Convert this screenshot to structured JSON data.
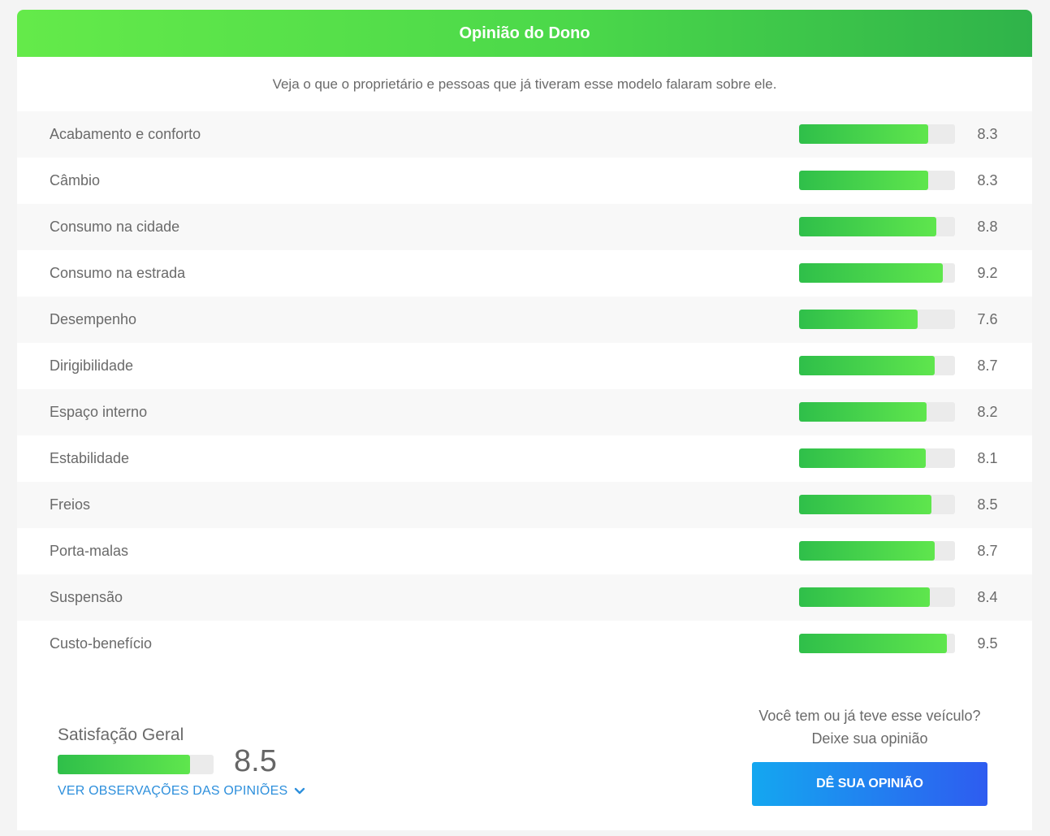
{
  "header": {
    "title": "Opinião do Dono"
  },
  "subtitle": "Veja o que o proprietário e pessoas que já tiveram esse modelo falaram sobre ele.",
  "ratings": [
    {
      "label": "Acabamento e conforto",
      "score": "8.3",
      "value": 8.3
    },
    {
      "label": "Câmbio",
      "score": "8.3",
      "value": 8.3
    },
    {
      "label": "Consumo na cidade",
      "score": "8.8",
      "value": 8.8
    },
    {
      "label": "Consumo na estrada",
      "score": "9.2",
      "value": 9.2
    },
    {
      "label": "Desempenho",
      "score": "7.6",
      "value": 7.6
    },
    {
      "label": "Dirigibilidade",
      "score": "8.7",
      "value": 8.7
    },
    {
      "label": "Espaço interno",
      "score": "8.2",
      "value": 8.2
    },
    {
      "label": "Estabilidade",
      "score": "8.1",
      "value": 8.1
    },
    {
      "label": "Freios",
      "score": "8.5",
      "value": 8.5
    },
    {
      "label": "Porta-malas",
      "score": "8.7",
      "value": 8.7
    },
    {
      "label": "Suspensão",
      "score": "8.4",
      "value": 8.4
    },
    {
      "label": "Custo-benefício",
      "score": "9.5",
      "value": 9.5
    }
  ],
  "scale_max": 10,
  "summary": {
    "title": "Satisfação Geral",
    "score": "8.5",
    "value": 8.5,
    "observations_link": "VER OBSERVAÇÕES DAS OPINIÕES",
    "link_icon": "chevron-down-icon"
  },
  "cta": {
    "question": "Você tem ou já teve esse veículo?",
    "prompt": "Deixe sua opinião",
    "button_label": "DÊ SUA OPINIÃO"
  },
  "colors": {
    "header_gradient": [
      "#64ea4a",
      "#2fb34a"
    ],
    "bar_gradient": [
      "#2fbf4a",
      "#5fe64d"
    ],
    "button_gradient": [
      "#14a7f0",
      "#2e5cf0"
    ],
    "link": "#2d8fdc"
  }
}
